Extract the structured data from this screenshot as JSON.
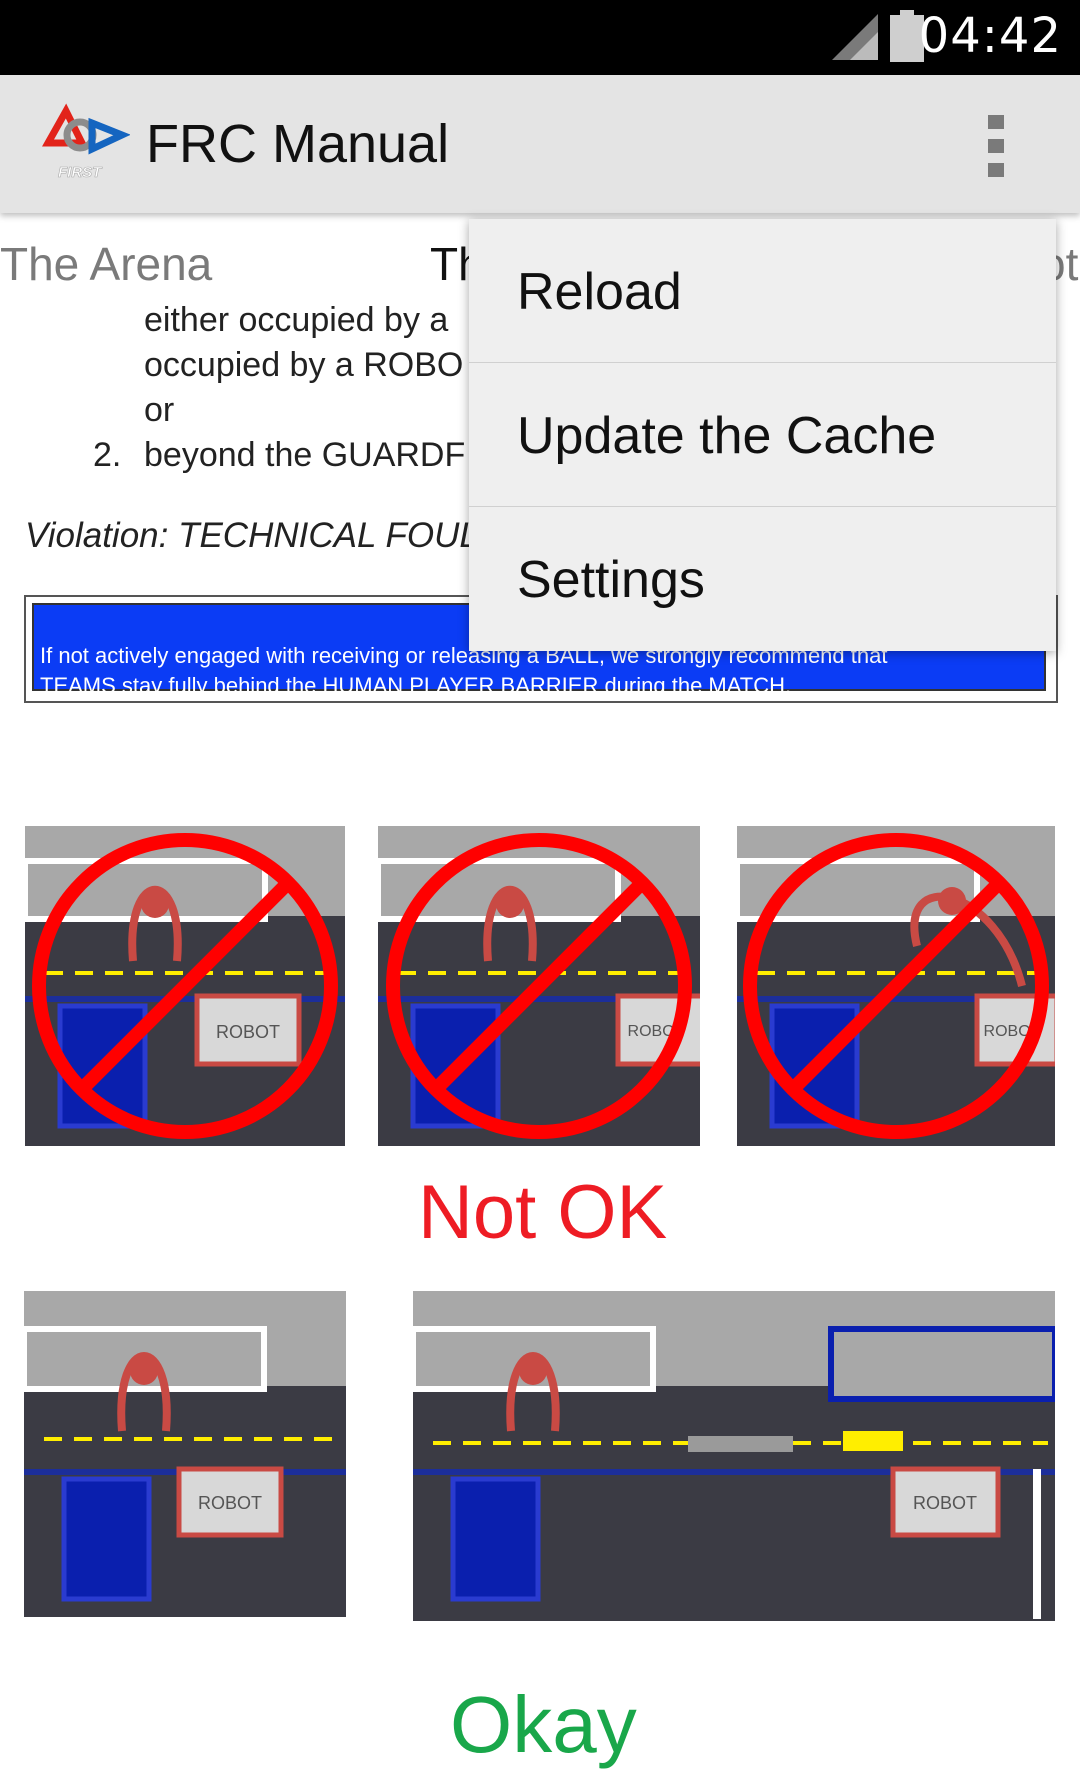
{
  "status_bar": {
    "time": "04:42"
  },
  "action_bar": {
    "title": "FRC Manual"
  },
  "tabs": {
    "left": "The Arena",
    "center": "Th",
    "right": "ot"
  },
  "content": {
    "line1": "either occupied by a",
    "line2": "occupied by a ROBO",
    "line3": "or",
    "item_number": "2.",
    "item_text": "beyond the GUARDF",
    "violation": "Violation: TECHNICAL FOUL.",
    "note_line1": "If not actively engaged with receiving or releasing a BALL, we strongly recommend that",
    "note_line2": "TEAMS stay fully behind the HUMAN PLAYER BARRIER during the MATCH.",
    "robot_label": "ROBOT",
    "not_ok_caption": "Not OK",
    "okay_caption": "Okay"
  },
  "menu": {
    "items": [
      {
        "label": "Reload"
      },
      {
        "label": "Update the Cache"
      },
      {
        "label": "Settings"
      }
    ]
  },
  "colors": {
    "not_ok": "#ee1c24",
    "okay": "#19a74a",
    "note_bg": "#0b3cf5",
    "menu_bg": "#efefef"
  }
}
